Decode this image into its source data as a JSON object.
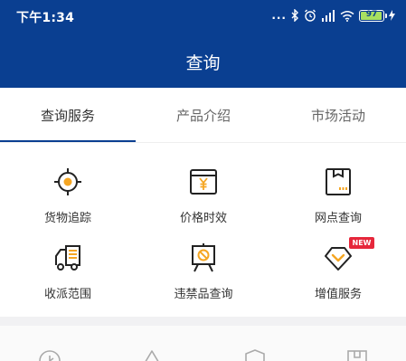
{
  "status_bar": {
    "time": "下午1:34",
    "dots": "...",
    "battery_level": "97",
    "battery_fraction": 0.97,
    "icons": [
      "bluetooth-icon",
      "alarm-icon",
      "signal-icon",
      "wifi-icon",
      "battery-icon",
      "charging-icon"
    ]
  },
  "header": {
    "title": "查询",
    "background_color": "#0a3f91"
  },
  "tabs": [
    {
      "label": "查询服务",
      "active": true
    },
    {
      "label": "产品介绍",
      "active": false
    },
    {
      "label": "市场活动",
      "active": false
    }
  ],
  "services": [
    {
      "label": "货物追踪",
      "icon": "crosshair-target-icon"
    },
    {
      "label": "价格时效",
      "icon": "price-yen-icon"
    },
    {
      "label": "网点查询",
      "icon": "outlet-box-icon"
    },
    {
      "label": "收派范围",
      "icon": "delivery-truck-icon"
    },
    {
      "label": "违禁品查询",
      "icon": "prohibited-item-icon"
    },
    {
      "label": "增值服务",
      "icon": "value-added-diamond-icon",
      "badge": "NEW"
    }
  ],
  "colors": {
    "accent": "#0a3f91",
    "highlight": "#f5a623",
    "badge": "#e6273b"
  }
}
